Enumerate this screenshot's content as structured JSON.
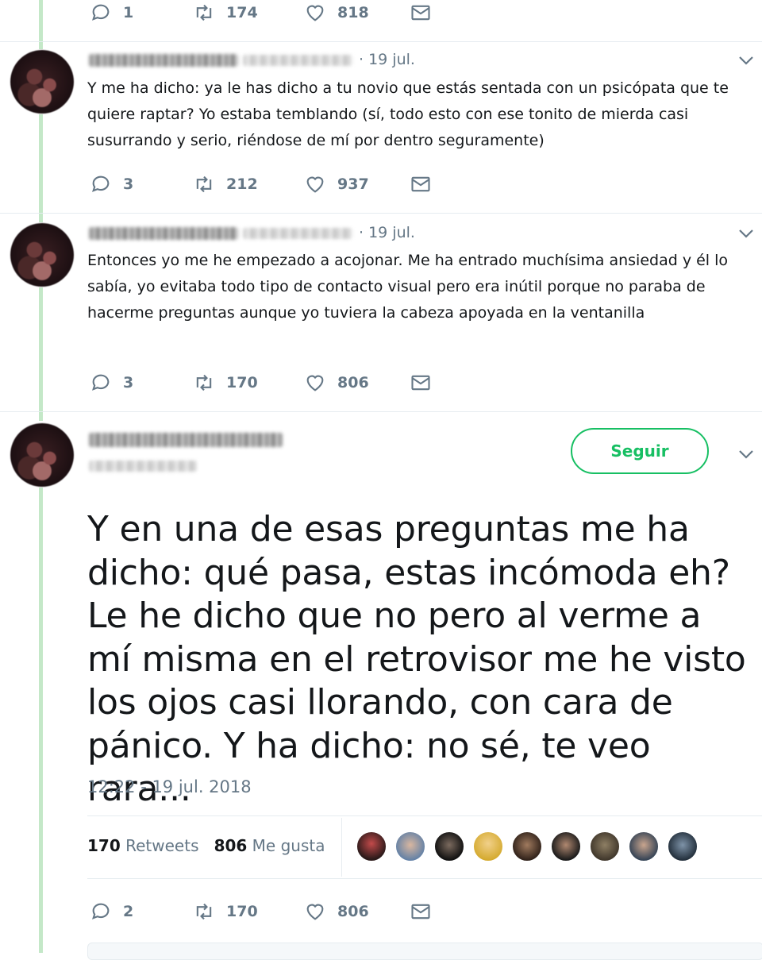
{
  "tweets": [
    {
      "actions": {
        "replies": "1",
        "retweets": "174",
        "likes": "818"
      }
    },
    {
      "date": "· 19 jul.",
      "text": "Y me ha dicho: ya le has dicho a tu novio que estás sentada con un psicópata que te quiere raptar? Yo estaba temblando (sí, todo esto con ese tonito de mierda casi susurrando y serio, riéndose de mí por dentro seguramente)",
      "actions": {
        "replies": "3",
        "retweets": "212",
        "likes": "937"
      }
    },
    {
      "date": "· 19 jul.",
      "text": "Entonces yo me he empezado a acojonar. Me ha entrado muchísima ansiedad y él lo sabía, yo evitaba todo tipo de contacto visual pero era inútil porque no paraba de hacerme preguntas aunque yo tuviera la cabeza apoyada en la ventanilla",
      "actions": {
        "replies": "3",
        "retweets": "170",
        "likes": "806"
      }
    }
  ],
  "main_tweet": {
    "follow_label": "Seguir",
    "text": "Y en una de esas preguntas me ha dicho: qué pasa, estas incómoda eh? Le he dicho que no pero al verme a mí misma en el retrovisor me he visto los ojos casi llorando, con cara de pánico. Y ha dicho: no sé, te veo rara...",
    "timestamp": "12:22 - 19 jul. 2018",
    "retweets_count": "170",
    "retweets_label": "Retweets",
    "likes_count": "806",
    "likes_label": "Me gusta",
    "actions": {
      "replies": "2",
      "retweets": "170",
      "likes": "806"
    }
  },
  "icons": {
    "reply": "reply-icon",
    "retweet": "retweet-icon",
    "like": "heart-icon",
    "dm": "envelope-icon",
    "more": "chevron-down-icon"
  },
  "colors": {
    "accent_green": "#17bf63",
    "thread_line": "#c4e8c8",
    "secondary_text": "#657786"
  }
}
